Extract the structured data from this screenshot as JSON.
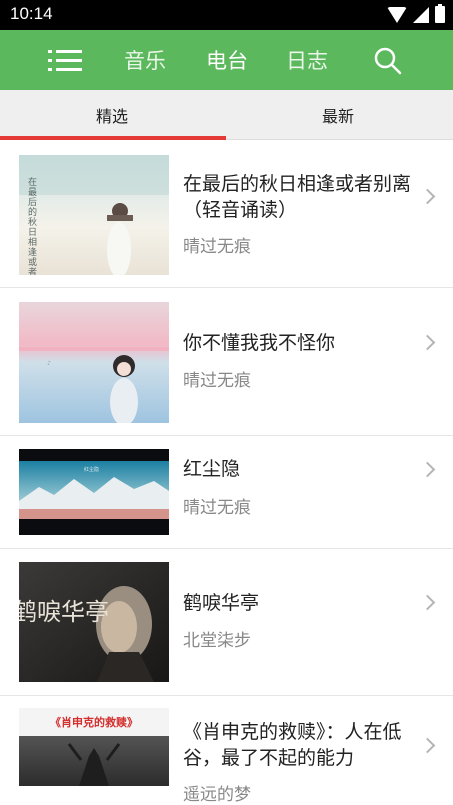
{
  "status_bar": {
    "time": "10:14"
  },
  "top_nav": {
    "items": [
      {
        "label": "音乐"
      },
      {
        "label": "电台"
      },
      {
        "label": "日志"
      }
    ],
    "active_index": 1,
    "brand_color": "#5cb85c"
  },
  "sub_tabs": {
    "tabs": [
      {
        "label": "精选"
      },
      {
        "label": "最新"
      }
    ],
    "active_index": 0,
    "indicator_color": "#e53935"
  },
  "list": {
    "items": [
      {
        "title": "在最后的秋日相逢或者别离 （轻音诵读）",
        "author": "晴过无痕"
      },
      {
        "title": "你不懂我我不怪你",
        "author": "晴过无痕"
      },
      {
        "title": "红尘隐",
        "author": "晴过无痕"
      },
      {
        "title": "鹤唳华亭",
        "author": "北堂柒步"
      },
      {
        "title": "《肖申克的救赎》：人在低谷，最了不起的能力",
        "author": "遥远的梦"
      }
    ]
  },
  "thumbnails": {
    "poster_1_text": "在最后的秋日相逢或者别离",
    "poster_3_text": "红尘隐",
    "poster_4_text": "鹤唳华亭",
    "poster_5_text": "《肖申克的救赎》"
  }
}
